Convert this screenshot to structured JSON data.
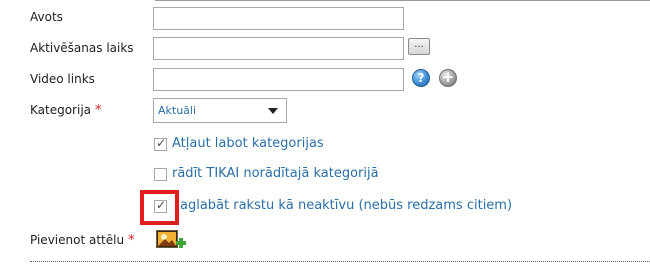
{
  "form": {
    "source": {
      "label": "Avots",
      "value": ""
    },
    "activation_time": {
      "label": "Aktivēšanas laiks",
      "value": "",
      "button_label": "..."
    },
    "video_link": {
      "label": "Video links",
      "value": "",
      "help_glyph": "?",
      "add_glyph": "+"
    },
    "category": {
      "label": "Kategorija",
      "required_mark": "*",
      "selected": "Aktuāli"
    },
    "options": [
      {
        "label": "Atļaut labot kategorijas",
        "checked": true
      },
      {
        "label": "rādīt TIKAI norādītajā kategorijā",
        "checked": false
      },
      {
        "label": "aglabāt rakstu kā neaktīvu (nebūs redzams citiem)",
        "checked": true
      }
    ],
    "add_image": {
      "label": "Pievienot attēlu",
      "required_mark": "*"
    }
  },
  "check_glyph": "✓",
  "colors": {
    "link_blue": "#2a6fa8",
    "required_red": "#e02020",
    "highlight_red": "#e11d1d",
    "help_blue": "#3f8fd6"
  },
  "icons": {
    "activation_picker": "ellipsis-button",
    "video_help": "help-icon",
    "video_add": "add-icon",
    "category_dropdown": "chevron-down-icon",
    "add_image": "add-image-icon"
  }
}
